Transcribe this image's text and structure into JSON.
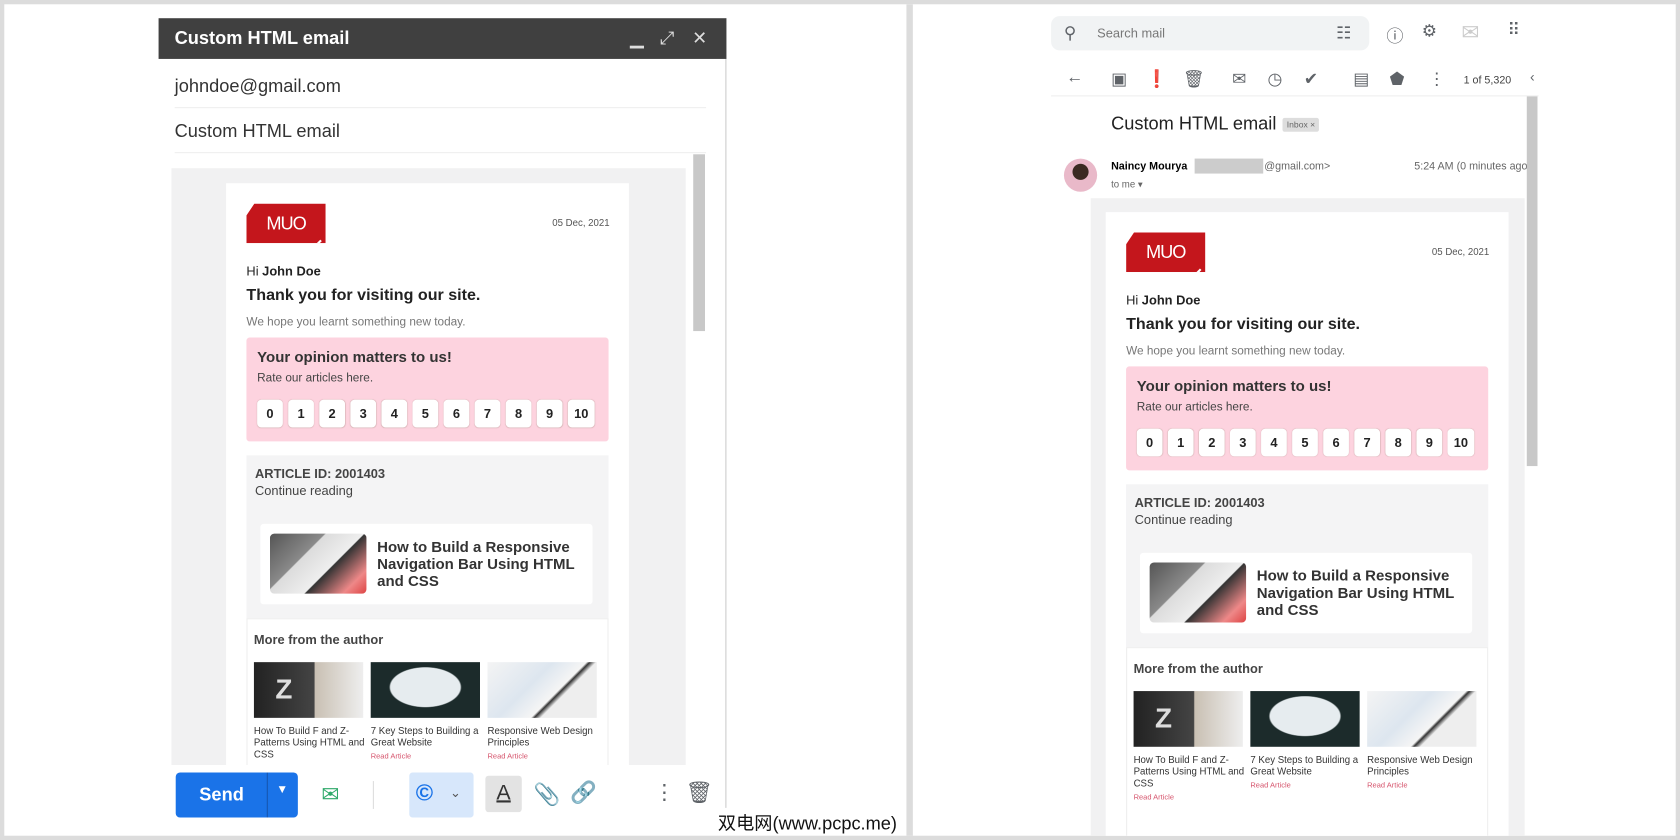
{
  "compose": {
    "title": "Custom HTML email",
    "to": "johndoe@gmail.com",
    "subject": "Custom HTML email",
    "send_label": "Send"
  },
  "gmail": {
    "search_placeholder": "Search mail",
    "pagination": "1 of 5,320",
    "subject": "Custom HTML email",
    "label_badge": "Inbox ×",
    "sender_name": "Naincy Mourya",
    "sender_email": "@gmail.com>",
    "time": "5:24 AM (0 minutes ago",
    "to_me": "to me ▾"
  },
  "email": {
    "logo": "MUO",
    "date": "05 Dec, 2021",
    "greeting": "Hi",
    "name": "John Doe",
    "thank": "Thank you for visiting our site.",
    "hope": "We hope you learnt something new today.",
    "opinion_title": "Your opinion matters to us!",
    "rate_text": "Rate our articles here.",
    "ratings": [
      "0",
      "1",
      "2",
      "3",
      "4",
      "5",
      "6",
      "7",
      "8",
      "9",
      "10"
    ],
    "article_id": "ARTICLE ID: 2001403",
    "continue": "Continue reading",
    "article_title": "How to Build a Responsive Navigation Bar Using HTML and CSS",
    "more_heading": "More from the author",
    "more": [
      {
        "title": "How To Build F and Z-Patterns Using HTML and CSS",
        "link": "Read Article"
      },
      {
        "title": "7 Key Steps to Building a Great Website",
        "link": "Read Article"
      },
      {
        "title": "Responsive Web Design Principles",
        "link": "Read Article"
      }
    ]
  },
  "watermark": "双电网(www.pcpc.me)",
  "colors": {
    "send": "#1a73e8",
    "brand": "#c4161c",
    "pink": "#fdd3df"
  }
}
